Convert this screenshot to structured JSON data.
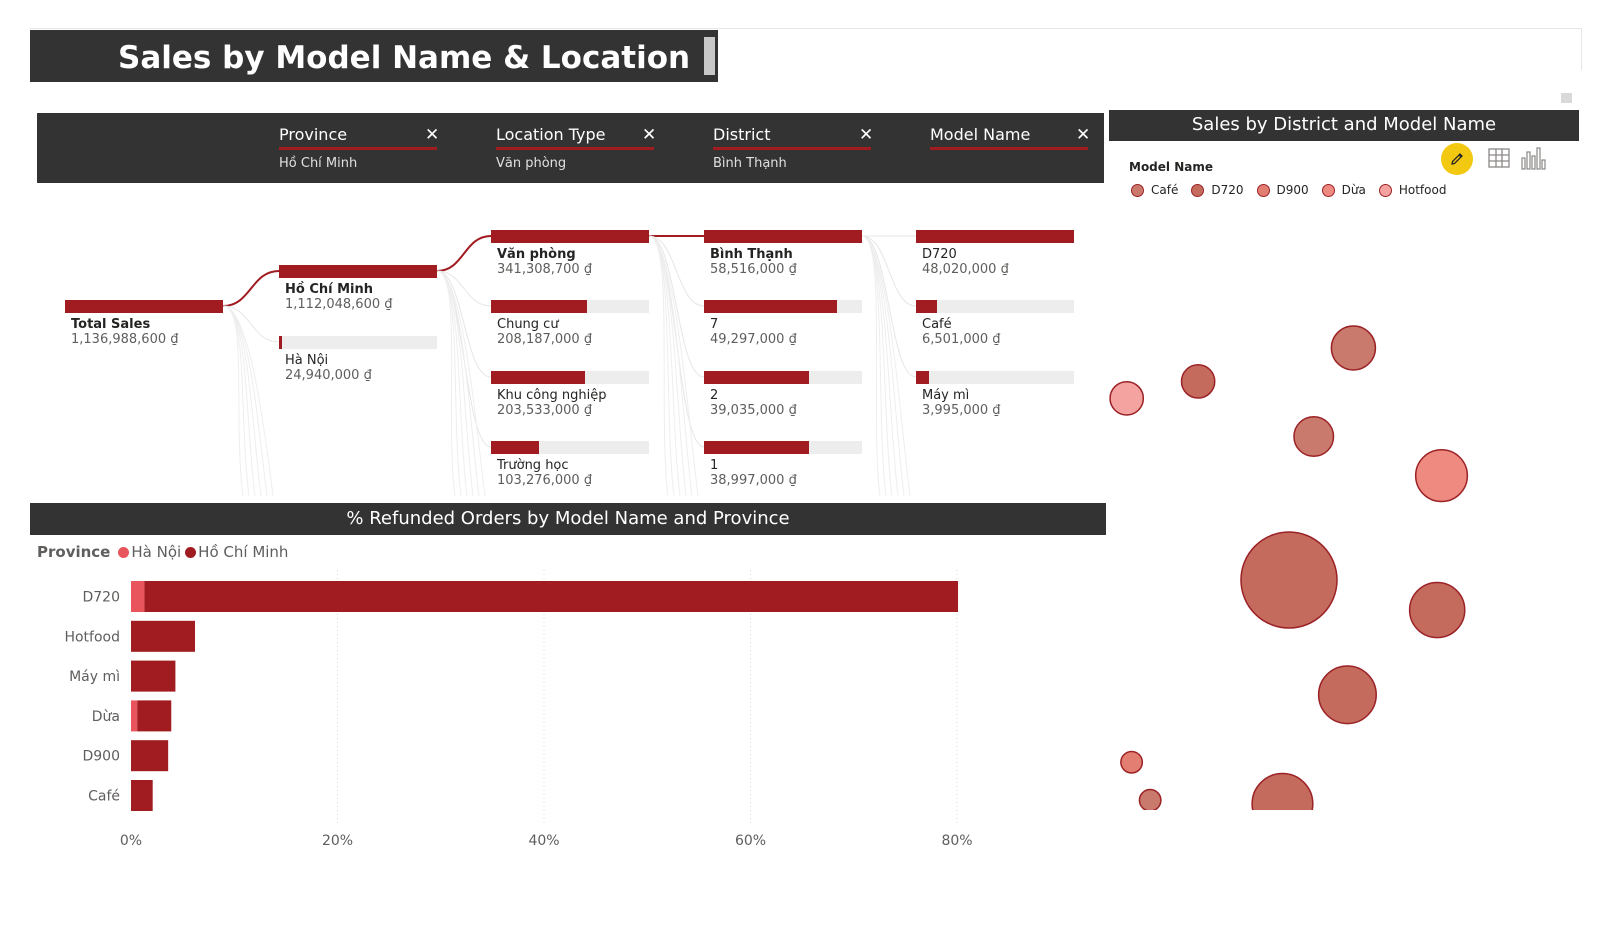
{
  "page_title": "Sales by Model Name & Location",
  "decomposition": {
    "columns": [
      {
        "label": "Province",
        "filter": "Hồ Chí Minh"
      },
      {
        "label": "Location Type",
        "filter": "Văn phòng"
      },
      {
        "label": "District",
        "filter": "Bình Thạnh"
      },
      {
        "label": "Model Name",
        "filter": ""
      }
    ],
    "root": {
      "label": "Total Sales",
      "value": "1,136,988,600 ₫",
      "fill": 1.0
    },
    "levels": [
      [
        {
          "label": "Hồ Chí Minh",
          "value": "1,112,048,600 ₫",
          "fill": 1.0,
          "selected": true
        },
        {
          "label": "Hà Nội",
          "value": "24,940,000 ₫",
          "fill": 0.022,
          "selected": false
        }
      ],
      [
        {
          "label": "Văn phòng",
          "value": "341,308,700 ₫",
          "fill": 1.0,
          "selected": true
        },
        {
          "label": "Chung cư",
          "value": "208,187,000 ₫",
          "fill": 0.61,
          "selected": false
        },
        {
          "label": "Khu công nghiệp",
          "value": "203,533,000 ₫",
          "fill": 0.596,
          "selected": false
        },
        {
          "label": "Trường học",
          "value": "103,276,000 ₫",
          "fill": 0.303,
          "selected": false
        }
      ],
      [
        {
          "label": "Bình Thạnh",
          "value": "58,516,000 ₫",
          "fill": 1.0,
          "selected": true
        },
        {
          "label": "7",
          "value": "49,297,000 ₫",
          "fill": 0.842,
          "selected": false
        },
        {
          "label": "2",
          "value": "39,035,000 ₫",
          "fill": 0.667,
          "selected": false
        },
        {
          "label": "1",
          "value": "38,997,000 ₫",
          "fill": 0.666,
          "selected": false
        }
      ],
      [
        {
          "label": "D720",
          "value": "48,020,000 ₫",
          "fill": 1.0,
          "selected": false
        },
        {
          "label": "Café",
          "value": "6,501,000 ₫",
          "fill": 0.135,
          "selected": false
        },
        {
          "label": "Máy mì",
          "value": "3,995,000 ₫",
          "fill": 0.083,
          "selected": false
        }
      ]
    ]
  },
  "refund_chart": {
    "title": "% Refunded Orders by Model Name and Province",
    "legend_title": "Province",
    "chart_data": {
      "type": "bar",
      "orientation": "horizontal",
      "stacked": true,
      "title": "% Refunded Orders by Model Name and Province",
      "categories": [
        "D720",
        "Hotfood",
        "Máy mì",
        "Dừa",
        "D900",
        "Café"
      ],
      "series": [
        {
          "name": "Hà Nội",
          "color": "#e8555c",
          "values": [
            1.3,
            0,
            0,
            0.6,
            0,
            0
          ]
        },
        {
          "name": "Hồ Chí Minh",
          "color": "#a01c21",
          "values": [
            78.8,
            6.2,
            4.3,
            3.3,
            3.6,
            2.1
          ]
        }
      ],
      "xlim": [
        0,
        92
      ],
      "xticks": [
        "0%",
        "20%",
        "40%",
        "60%",
        "80%"
      ],
      "xtick_values": [
        0,
        20,
        40,
        60,
        80
      ],
      "grid": "vertical dotted"
    }
  },
  "bubble_chart": {
    "title": "Sales by District and Model Name",
    "legend_title": "Model Name",
    "legend": [
      {
        "name": "Café",
        "color": "#c97a6c"
      },
      {
        "name": "D720",
        "color": "#c46b5e"
      },
      {
        "name": "D900",
        "color": "#e37f72"
      },
      {
        "name": "Dừa",
        "color": "#ee8a80"
      },
      {
        "name": "Hotfood",
        "color": "#f5a3a0"
      }
    ],
    "toolbar": {
      "edit_icon": "pencil-icon",
      "table_icon": "table-icon",
      "viz_icon": "bar-chart-icon"
    },
    "bubbles": [
      {
        "model": "D720",
        "size": 1.0
      },
      {
        "model": "D720",
        "size": 0.42
      },
      {
        "model": "D720",
        "size": 0.4
      },
      {
        "model": "D720",
        "size": 0.36
      },
      {
        "model": "D720",
        "size": 0.33
      },
      {
        "model": "Dừa",
        "size": 0.29
      },
      {
        "model": "Café",
        "size": 0.21
      },
      {
        "model": "Café",
        "size": 0.17
      },
      {
        "model": "D720",
        "size": 0.12
      },
      {
        "model": "Hotfood",
        "size": 0.12
      },
      {
        "model": "Dừa",
        "size": 0.1
      },
      {
        "model": "D720",
        "size": 0.1
      },
      {
        "model": "D900",
        "size": 0.08
      },
      {
        "model": "D720",
        "size": 0.08
      },
      {
        "model": "D900",
        "size": 0.07
      },
      {
        "model": "Dừa",
        "size": 0.07
      },
      {
        "model": "D900",
        "size": 0.05
      },
      {
        "model": "Café",
        "size": 0.05
      },
      {
        "model": "Hotfood",
        "size": 0.03
      }
    ]
  }
}
